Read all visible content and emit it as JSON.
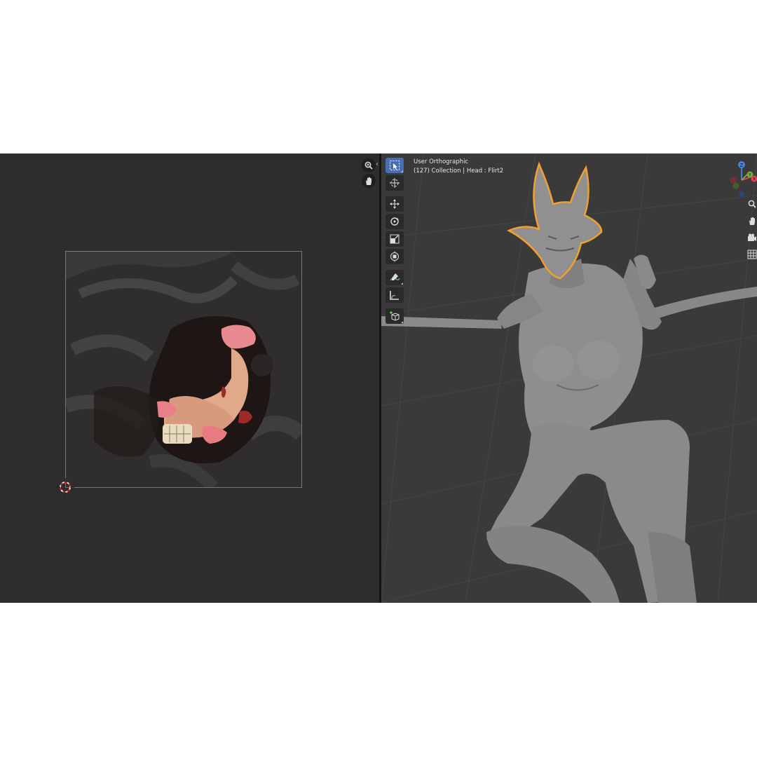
{
  "viewport": {
    "view_name": "User Orthographic",
    "object_info": "(127) Collection | Head : Flirt2"
  },
  "uv_editor": {
    "nav_buttons": [
      "zoom-icon",
      "hand-icon"
    ],
    "collapse_arrow": "‹"
  },
  "toolbar": {
    "tools": [
      "select-box-icon",
      "cursor-icon",
      "move-icon",
      "rotate-icon",
      "scale-icon",
      "transform-icon",
      "annotate-icon",
      "measure-icon",
      "add-cube-icon"
    ],
    "active_tool": "select-box-icon"
  },
  "gizmo": {
    "axes": [
      "Z",
      "Y",
      "X"
    ],
    "colors": {
      "x": "#e0475a",
      "y": "#76b03a",
      "z": "#4a86d6"
    }
  },
  "side_nav": [
    "zoom-icon",
    "hand-icon",
    "camera-icon",
    "grid-icon"
  ],
  "colors": {
    "selection_outline": "#f0a030",
    "active_tool": "#4a6fb0",
    "model": "#8c8c8c"
  }
}
